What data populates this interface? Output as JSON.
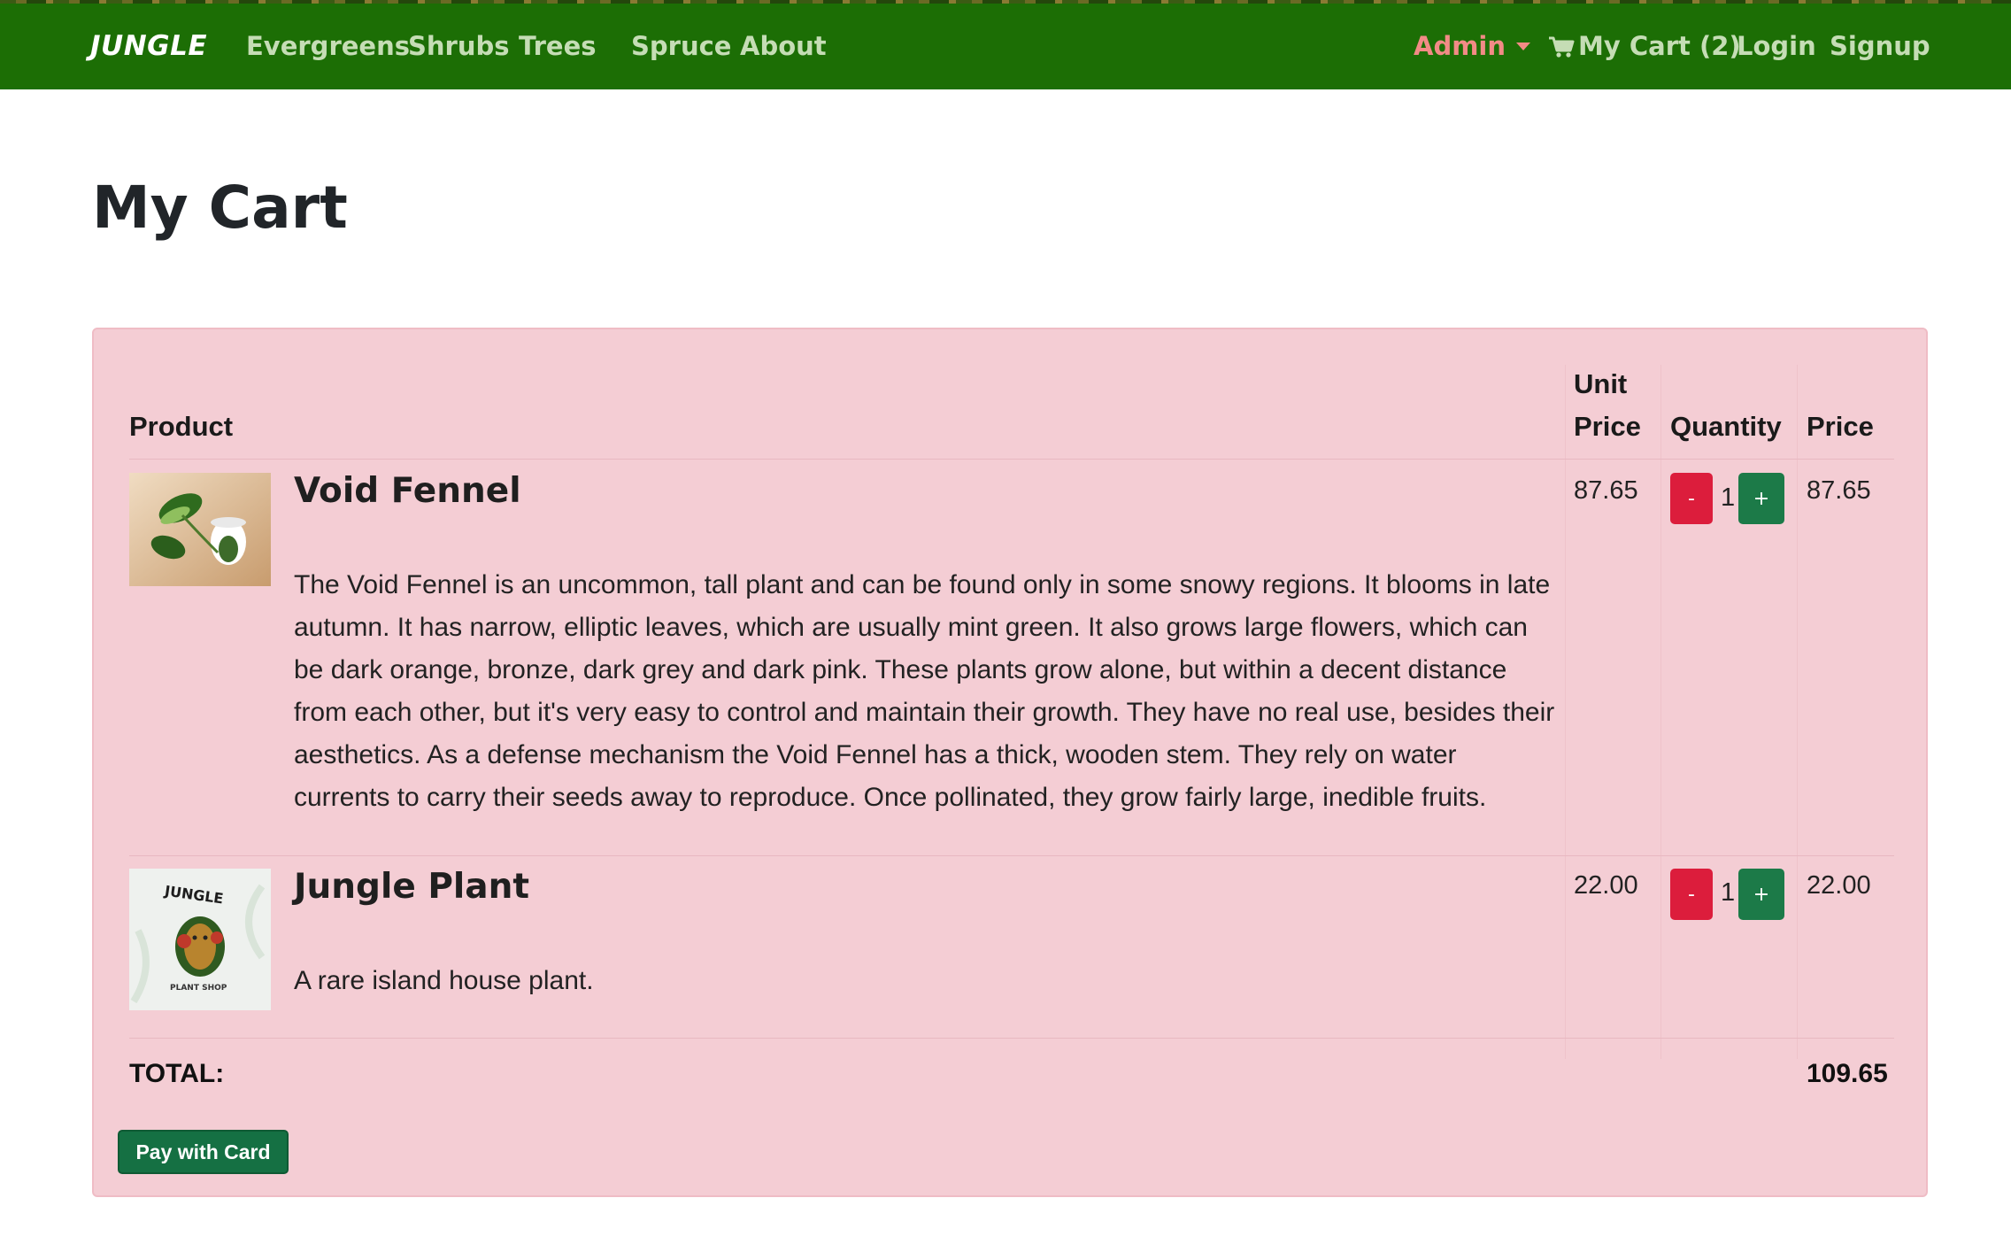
{
  "nav": {
    "brand": "JUNGLE",
    "links": [
      "Evergreens",
      "Shrubs",
      "Trees",
      "Spruce",
      "About"
    ],
    "admin": "Admin",
    "cart": "My Cart (2)",
    "login": "Login",
    "signup": "Signup"
  },
  "page": {
    "title": "My Cart"
  },
  "table": {
    "headers": {
      "product": "Product",
      "unit_price_line1": "Unit",
      "unit_price_line2": "Price",
      "quantity": "Quantity",
      "price": "Price"
    },
    "items": [
      {
        "name": "Void Fennel",
        "description": "The Void Fennel is an uncommon, tall plant and can be found only in some snowy regions. It blooms in late autumn. It has narrow, elliptic leaves, which are usually mint green. It also grows large flowers, which can be dark orange, bronze, dark grey and dark pink. These plants grow alone, but within a decent distance from each other, but it's very easy to control and maintain their growth. They have no real use, besides their aesthetics. As a defense mechanism the Void Fennel has a thick, wooden stem. They rely on water currents to carry their seeds away to reproduce. Once pollinated, they grow fairly large, inedible fruits.",
        "unit_price": "87.65",
        "quantity": "1",
        "price": "87.65",
        "minus": "-",
        "plus": "+"
      },
      {
        "name": "Jungle Plant",
        "description": "A rare island house plant.",
        "unit_price": "22.00",
        "quantity": "1",
        "price": "22.00",
        "minus": "-",
        "plus": "+",
        "thumb_logo_top": "JUNGLE",
        "thumb_logo_bottom": "PLANT SHOP"
      }
    ],
    "total_label": "TOTAL:",
    "total_value": "109.65"
  },
  "pay_button": "Pay with Card",
  "colors": {
    "navbar": "#1c6e05",
    "panel": "#f4cdd4",
    "minus_button": "#dc1d3c",
    "plus_button": "#1c7a48",
    "pay_button": "#157043"
  }
}
